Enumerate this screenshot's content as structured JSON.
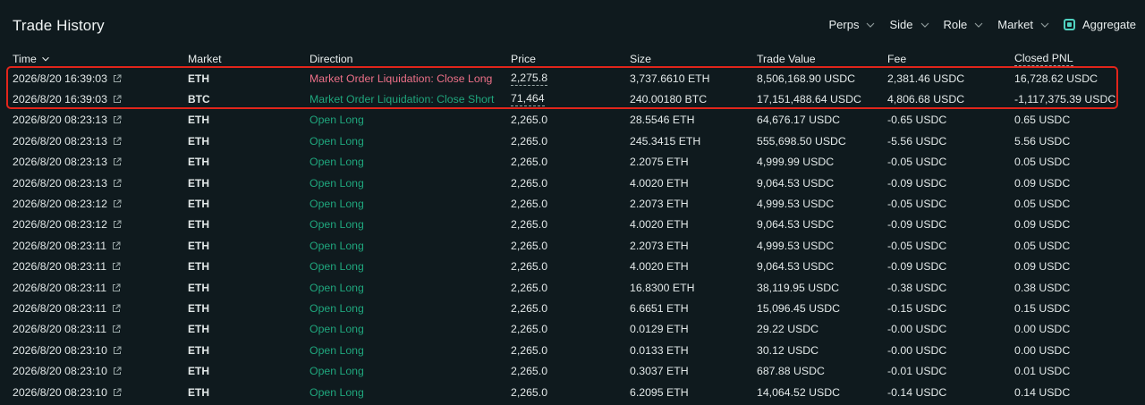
{
  "header": {
    "title": "Trade History",
    "filters": [
      "Perps",
      "Side",
      "Role",
      "Market"
    ],
    "aggregate_label": "Aggregate"
  },
  "columns": {
    "time": "Time",
    "market": "Market",
    "direction": "Direction",
    "price": "Price",
    "size": "Size",
    "trade_value": "Trade Value",
    "fee": "Fee",
    "closed_pnl": "Closed PNL"
  },
  "colors": {
    "accent": "#50d2c1",
    "market_green": "#5fd5c4",
    "market_red": "#ed7088",
    "direction_green": "#1fa67d",
    "direction_red": "#ed7088",
    "highlight_border": "#e1251b",
    "background": "#0f1a1e"
  },
  "rows": [
    {
      "time": "2026/8/20 16:39:03",
      "market": "ETH",
      "market_color": "red",
      "direction": "Market Order Liquidation: Close Long",
      "direction_color": "red",
      "price": "2,275.8",
      "price_underlined": true,
      "size": "3,737.6610 ETH",
      "trade_value": "8,506,168.90 USDC",
      "fee": "2,381.46 USDC",
      "closed_pnl": "16,728.62 USDC"
    },
    {
      "time": "2026/8/20 16:39:03",
      "market": "BTC",
      "market_color": "green",
      "direction": "Market Order Liquidation: Close Short",
      "direction_color": "green",
      "price": "71,464",
      "price_underlined": true,
      "size": "240.00180 BTC",
      "trade_value": "17,151,488.64 USDC",
      "fee": "4,806.68 USDC",
      "closed_pnl": "-1,117,375.39 USDC"
    },
    {
      "time": "2026/8/20 08:23:13",
      "market": "ETH",
      "market_color": "green",
      "direction": "Open Long",
      "direction_color": "green",
      "price": "2,265.0",
      "size": "28.5546 ETH",
      "trade_value": "64,676.17 USDC",
      "fee": "-0.65 USDC",
      "closed_pnl": "0.65 USDC"
    },
    {
      "time": "2026/8/20 08:23:13",
      "market": "ETH",
      "market_color": "green",
      "direction": "Open Long",
      "direction_color": "green",
      "price": "2,265.0",
      "size": "245.3415 ETH",
      "trade_value": "555,698.50 USDC",
      "fee": "-5.56 USDC",
      "closed_pnl": "5.56 USDC"
    },
    {
      "time": "2026/8/20 08:23:13",
      "market": "ETH",
      "market_color": "green",
      "direction": "Open Long",
      "direction_color": "green",
      "price": "2,265.0",
      "size": "2.2075 ETH",
      "trade_value": "4,999.99 USDC",
      "fee": "-0.05 USDC",
      "closed_pnl": "0.05 USDC"
    },
    {
      "time": "2026/8/20 08:23:13",
      "market": "ETH",
      "market_color": "green",
      "direction": "Open Long",
      "direction_color": "green",
      "price": "2,265.0",
      "size": "4.0020 ETH",
      "trade_value": "9,064.53 USDC",
      "fee": "-0.09 USDC",
      "closed_pnl": "0.09 USDC"
    },
    {
      "time": "2026/8/20 08:23:12",
      "market": "ETH",
      "market_color": "green",
      "direction": "Open Long",
      "direction_color": "green",
      "price": "2,265.0",
      "size": "2.2073 ETH",
      "trade_value": "4,999.53 USDC",
      "fee": "-0.05 USDC",
      "closed_pnl": "0.05 USDC"
    },
    {
      "time": "2026/8/20 08:23:12",
      "market": "ETH",
      "market_color": "green",
      "direction": "Open Long",
      "direction_color": "green",
      "price": "2,265.0",
      "size": "4.0020 ETH",
      "trade_value": "9,064.53 USDC",
      "fee": "-0.09 USDC",
      "closed_pnl": "0.09 USDC"
    },
    {
      "time": "2026/8/20 08:23:11",
      "market": "ETH",
      "market_color": "green",
      "direction": "Open Long",
      "direction_color": "green",
      "price": "2,265.0",
      "size": "2.2073 ETH",
      "trade_value": "4,999.53 USDC",
      "fee": "-0.05 USDC",
      "closed_pnl": "0.05 USDC"
    },
    {
      "time": "2026/8/20 08:23:11",
      "market": "ETH",
      "market_color": "green",
      "direction": "Open Long",
      "direction_color": "green",
      "price": "2,265.0",
      "size": "4.0020 ETH",
      "trade_value": "9,064.53 USDC",
      "fee": "-0.09 USDC",
      "closed_pnl": "0.09 USDC"
    },
    {
      "time": "2026/8/20 08:23:11",
      "market": "ETH",
      "market_color": "green",
      "direction": "Open Long",
      "direction_color": "green",
      "price": "2,265.0",
      "size": "16.8300 ETH",
      "trade_value": "38,119.95 USDC",
      "fee": "-0.38 USDC",
      "closed_pnl": "0.38 USDC"
    },
    {
      "time": "2026/8/20 08:23:11",
      "market": "ETH",
      "market_color": "green",
      "direction": "Open Long",
      "direction_color": "green",
      "price": "2,265.0",
      "size": "6.6651 ETH",
      "trade_value": "15,096.45 USDC",
      "fee": "-0.15 USDC",
      "closed_pnl": "0.15 USDC"
    },
    {
      "time": "2026/8/20 08:23:11",
      "market": "ETH",
      "market_color": "green",
      "direction": "Open Long",
      "direction_color": "green",
      "price": "2,265.0",
      "size": "0.0129 ETH",
      "trade_value": "29.22 USDC",
      "fee": "-0.00 USDC",
      "closed_pnl": "0.00 USDC"
    },
    {
      "time": "2026/8/20 08:23:10",
      "market": "ETH",
      "market_color": "green",
      "direction": "Open Long",
      "direction_color": "green",
      "price": "2,265.0",
      "size": "0.0133 ETH",
      "trade_value": "30.12 USDC",
      "fee": "-0.00 USDC",
      "closed_pnl": "0.00 USDC"
    },
    {
      "time": "2026/8/20 08:23:10",
      "market": "ETH",
      "market_color": "green",
      "direction": "Open Long",
      "direction_color": "green",
      "price": "2,265.0",
      "size": "0.3037 ETH",
      "trade_value": "687.88 USDC",
      "fee": "-0.01 USDC",
      "closed_pnl": "0.01 USDC"
    },
    {
      "time": "2026/8/20 08:23:10",
      "market": "ETH",
      "market_color": "green",
      "direction": "Open Long",
      "direction_color": "green",
      "price": "2,265.0",
      "size": "6.2095 ETH",
      "trade_value": "14,064.52 USDC",
      "fee": "-0.14 USDC",
      "closed_pnl": "0.14 USDC"
    }
  ]
}
